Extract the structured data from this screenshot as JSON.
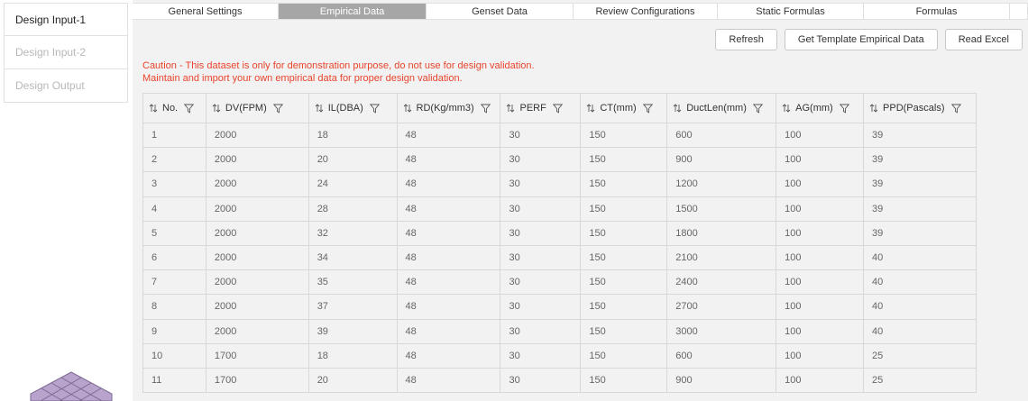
{
  "sidebar": {
    "items": [
      {
        "label": "Design Input-1",
        "active": true
      },
      {
        "label": "Design Input-2",
        "active": false
      },
      {
        "label": "Design Output",
        "active": false
      }
    ]
  },
  "tabs": [
    {
      "label": "General Settings",
      "active": false
    },
    {
      "label": "Empirical Data",
      "active": true
    },
    {
      "label": "Genset Data",
      "active": false
    },
    {
      "label": "Review Configurations",
      "active": false
    },
    {
      "label": "Static Formulas",
      "active": false
    },
    {
      "label": "Formulas",
      "active": false
    },
    {
      "label": "",
      "active": false
    }
  ],
  "toolbar": {
    "refresh_label": "Refresh",
    "template_label": "Get Template Empirical Data",
    "read_excel_label": "Read Excel"
  },
  "caution": {
    "line1": "Caution - This dataset is only for demonstration purpose, do not use for design validation.",
    "line2": "Maintain and import your own empirical data for proper design validation."
  },
  "table": {
    "columns": [
      "No.",
      "DV(FPM)",
      "IL(DBA)",
      "RD(Kg/mm3)",
      "PERF",
      "CT(mm)",
      "DuctLen(mm)",
      "AG(mm)",
      "PPD(Pascals)"
    ],
    "rows": [
      [
        "1",
        "2000",
        "18",
        "48",
        "30",
        "150",
        "600",
        "100",
        "39"
      ],
      [
        "2",
        "2000",
        "20",
        "48",
        "30",
        "150",
        "900",
        "100",
        "39"
      ],
      [
        "3",
        "2000",
        "24",
        "48",
        "30",
        "150",
        "1200",
        "100",
        "39"
      ],
      [
        "4",
        "2000",
        "28",
        "48",
        "30",
        "150",
        "1500",
        "100",
        "39"
      ],
      [
        "5",
        "2000",
        "32",
        "48",
        "30",
        "150",
        "1800",
        "100",
        "39"
      ],
      [
        "6",
        "2000",
        "34",
        "48",
        "30",
        "150",
        "2100",
        "100",
        "40"
      ],
      [
        "7",
        "2000",
        "35",
        "48",
        "30",
        "150",
        "2400",
        "100",
        "40"
      ],
      [
        "8",
        "2000",
        "37",
        "48",
        "30",
        "150",
        "2700",
        "100",
        "40"
      ],
      [
        "9",
        "2000",
        "39",
        "48",
        "30",
        "150",
        "3000",
        "100",
        "40"
      ],
      [
        "10",
        "1700",
        "18",
        "48",
        "30",
        "150",
        "600",
        "100",
        "25"
      ],
      [
        "11",
        "1700",
        "20",
        "48",
        "30",
        "150",
        "900",
        "100",
        "25"
      ]
    ]
  },
  "icons": {
    "sort": "sort-arrows-icon",
    "filter": "filter-funnel-icon",
    "logo": "isometric-grid-logo"
  },
  "colors": {
    "active_tab": "#a6a6a6",
    "caution": "#e8442c",
    "logo_fill": "#b7a3cc"
  }
}
